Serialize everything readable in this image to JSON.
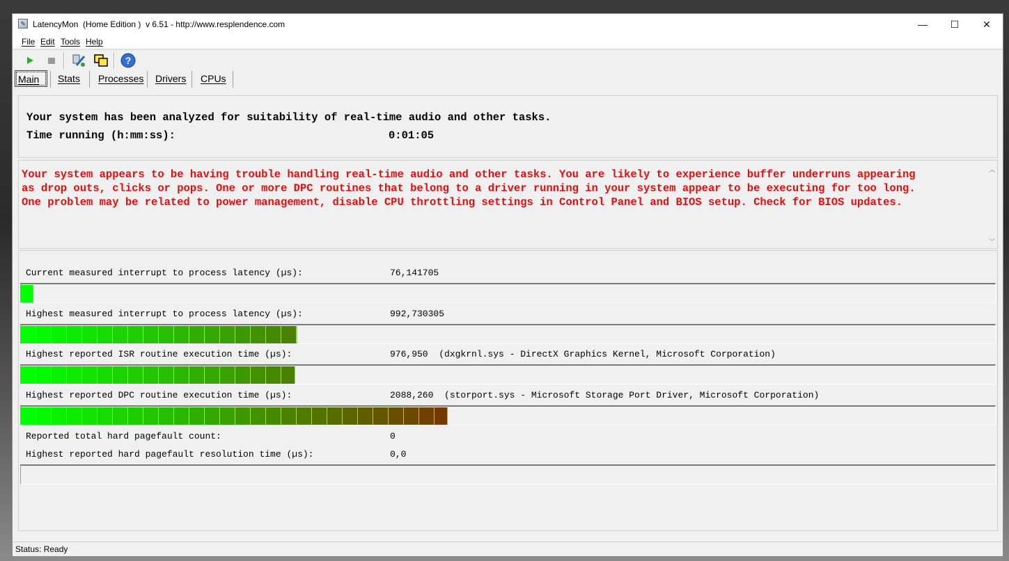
{
  "window": {
    "title": "LatencyMon  (Home Edition )  v 6.51 - http://www.resplendence.com",
    "controls": {
      "minimize": "—",
      "maximize": "☐",
      "close": "✕"
    }
  },
  "menu": {
    "file": "File",
    "edit": "Edit",
    "tools": "Tools",
    "help": "Help"
  },
  "toolbar": {
    "start_icon": "play-icon",
    "stop_icon": "stop-icon",
    "wand_icon": "settings-wand-icon",
    "windows_icon": "windows-icon",
    "help_icon": "help-icon"
  },
  "tabs": [
    "Main",
    "Stats",
    "Processes",
    "Drivers",
    "CPUs"
  ],
  "info": {
    "analyzed": "Your system has been analyzed for suitability of real-time audio and other tasks.",
    "time_label": "Time running (h:mm:ss):",
    "time_value": "0:01:05"
  },
  "warning": "Your system appears to be having trouble handling real-time audio and other tasks. You are likely to experience buffer underruns appearing\nas drop outs, clicks or pops. One or more DPC routines that belong to a driver running in your system appear to be executing for too long.\nOne problem may be related to power management, disable CPU throttling settings in Control Panel and BIOS setup. Check for BIOS updates.",
  "metrics": [
    {
      "label": "Current measured interrupt to process latency (µs):",
      "value": "76,141705",
      "bar_level": 0.013
    },
    {
      "label": "Highest measured interrupt to process latency (µs):",
      "value": "992,730305",
      "bar_level": 0.284
    },
    {
      "label": "Highest reported ISR routine execution time (µs):",
      "value": "976,950  (dxgkrnl.sys - DirectX Graphics Kernel, Microsoft Corporation)",
      "bar_level": 0.282
    },
    {
      "label": "Highest reported DPC routine execution time (µs):",
      "value": "2088,260  (storport.sys - Microsoft Storage Port Driver, Microsoft Corporation)",
      "bar_level": 0.439
    },
    {
      "label": "Reported total hard pagefault count:",
      "value": "0"
    },
    {
      "label": "Highest reported hard pagefault resolution time (µs):",
      "value": "0,0",
      "bar_level": 0
    }
  ],
  "status": "Status: Ready",
  "colors": {
    "bar_start": "#00ff00",
    "bar_end": "#7a3000",
    "warning": "#e01010"
  }
}
